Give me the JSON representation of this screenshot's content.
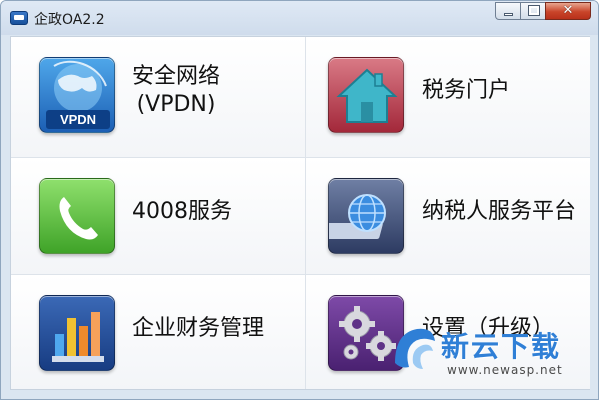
{
  "window": {
    "title": "企政OA2.2"
  },
  "tiles": [
    {
      "label_line1": "安全网络",
      "label_line2": "(VPDN)",
      "icon": "vpdn-icon",
      "badge": "VPDN"
    },
    {
      "label": "税务门户",
      "icon": "house-icon"
    },
    {
      "label": "4008服务",
      "icon": "phone-icon"
    },
    {
      "label": "纳税人服务平台",
      "icon": "globe-icon"
    },
    {
      "label": "企业财务管理",
      "icon": "bar-chart-icon"
    },
    {
      "label": "设置（升级）",
      "icon": "gears-icon"
    }
  ],
  "watermark": {
    "text": "新云下载",
    "url": "www.newasp.net"
  },
  "colors": {
    "titlebar": "#d6e3f0",
    "close": "#c9452a",
    "tile_vpdn": "#2b7fd0",
    "tile_home": "#b83a4b",
    "tile_phone": "#56b83a",
    "tile_globe": "#3d4b73",
    "tile_chart": "#23519b",
    "tile_gear": "#5e3287"
  }
}
